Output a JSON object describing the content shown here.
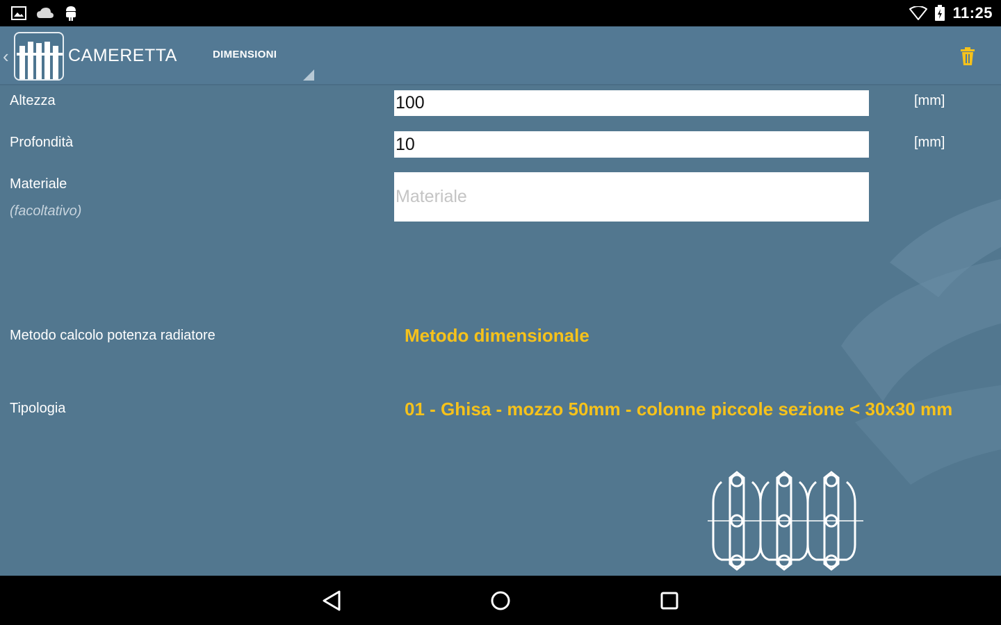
{
  "status_bar": {
    "time": "11:25",
    "left_icons": [
      "image-icon",
      "cloud-icon",
      "android-icon"
    ],
    "right_icons": [
      "wifi-icon",
      "battery-icon"
    ]
  },
  "toolbar": {
    "title": "CAMERETTA",
    "section": "DIMENSIONI",
    "delete_icon": "trash-icon"
  },
  "form": {
    "altezza": {
      "label": "Altezza",
      "value": "100",
      "unit": "[mm]"
    },
    "profondita": {
      "label": "Profondità",
      "value": "10",
      "unit": "[mm]"
    },
    "materiale": {
      "label": "Materiale",
      "hint": "(facoltativo)",
      "value": "",
      "placeholder": "Materiale"
    },
    "metodo": {
      "label": "Metodo calcolo potenza radiatore",
      "value": "Metodo dimensionale"
    },
    "tipologia": {
      "label": "Tipologia",
      "value": "01 - Ghisa - mozzo 50mm - colonne piccole sezione < 30x30 mm"
    }
  },
  "nav_bar": {
    "buttons": [
      "back-icon",
      "home-icon",
      "recents-icon"
    ]
  },
  "colors": {
    "background": "#52778f",
    "accent": "#f6c21b",
    "toolbar": "#537994"
  }
}
